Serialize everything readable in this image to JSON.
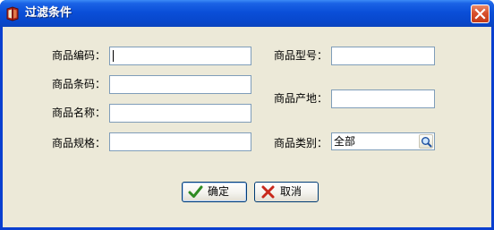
{
  "window": {
    "title": "过滤条件",
    "icon": "book-icon",
    "close_icon": "close-icon"
  },
  "form": {
    "product_code_label": "商品编码：",
    "product_code_value": "",
    "product_model_label": "商品型号：",
    "product_model_value": "",
    "product_bar_label": "商品条码：",
    "product_bar_value": "",
    "product_origin_label": "商品产地：",
    "product_origin_value": "",
    "product_name_label": "商品名称：",
    "product_name_value": "",
    "product_spec_label": "商品规格：",
    "product_spec_value": "",
    "product_category_label": "商品类别：",
    "product_category_value": "全部",
    "product_category_lookup_icon": "magnifier-icon"
  },
  "buttons": {
    "ok_label": "确定",
    "ok_icon": "checkmark-icon",
    "cancel_label": "取消",
    "cancel_icon": "x-icon"
  },
  "colors": {
    "titlebar": "#0a4fd8",
    "client_bg": "#ece9d8",
    "field_border": "#7f9db9",
    "close_button": "#d8502c",
    "ok_check": "#2e8b22",
    "cancel_x": "#c8281c"
  }
}
